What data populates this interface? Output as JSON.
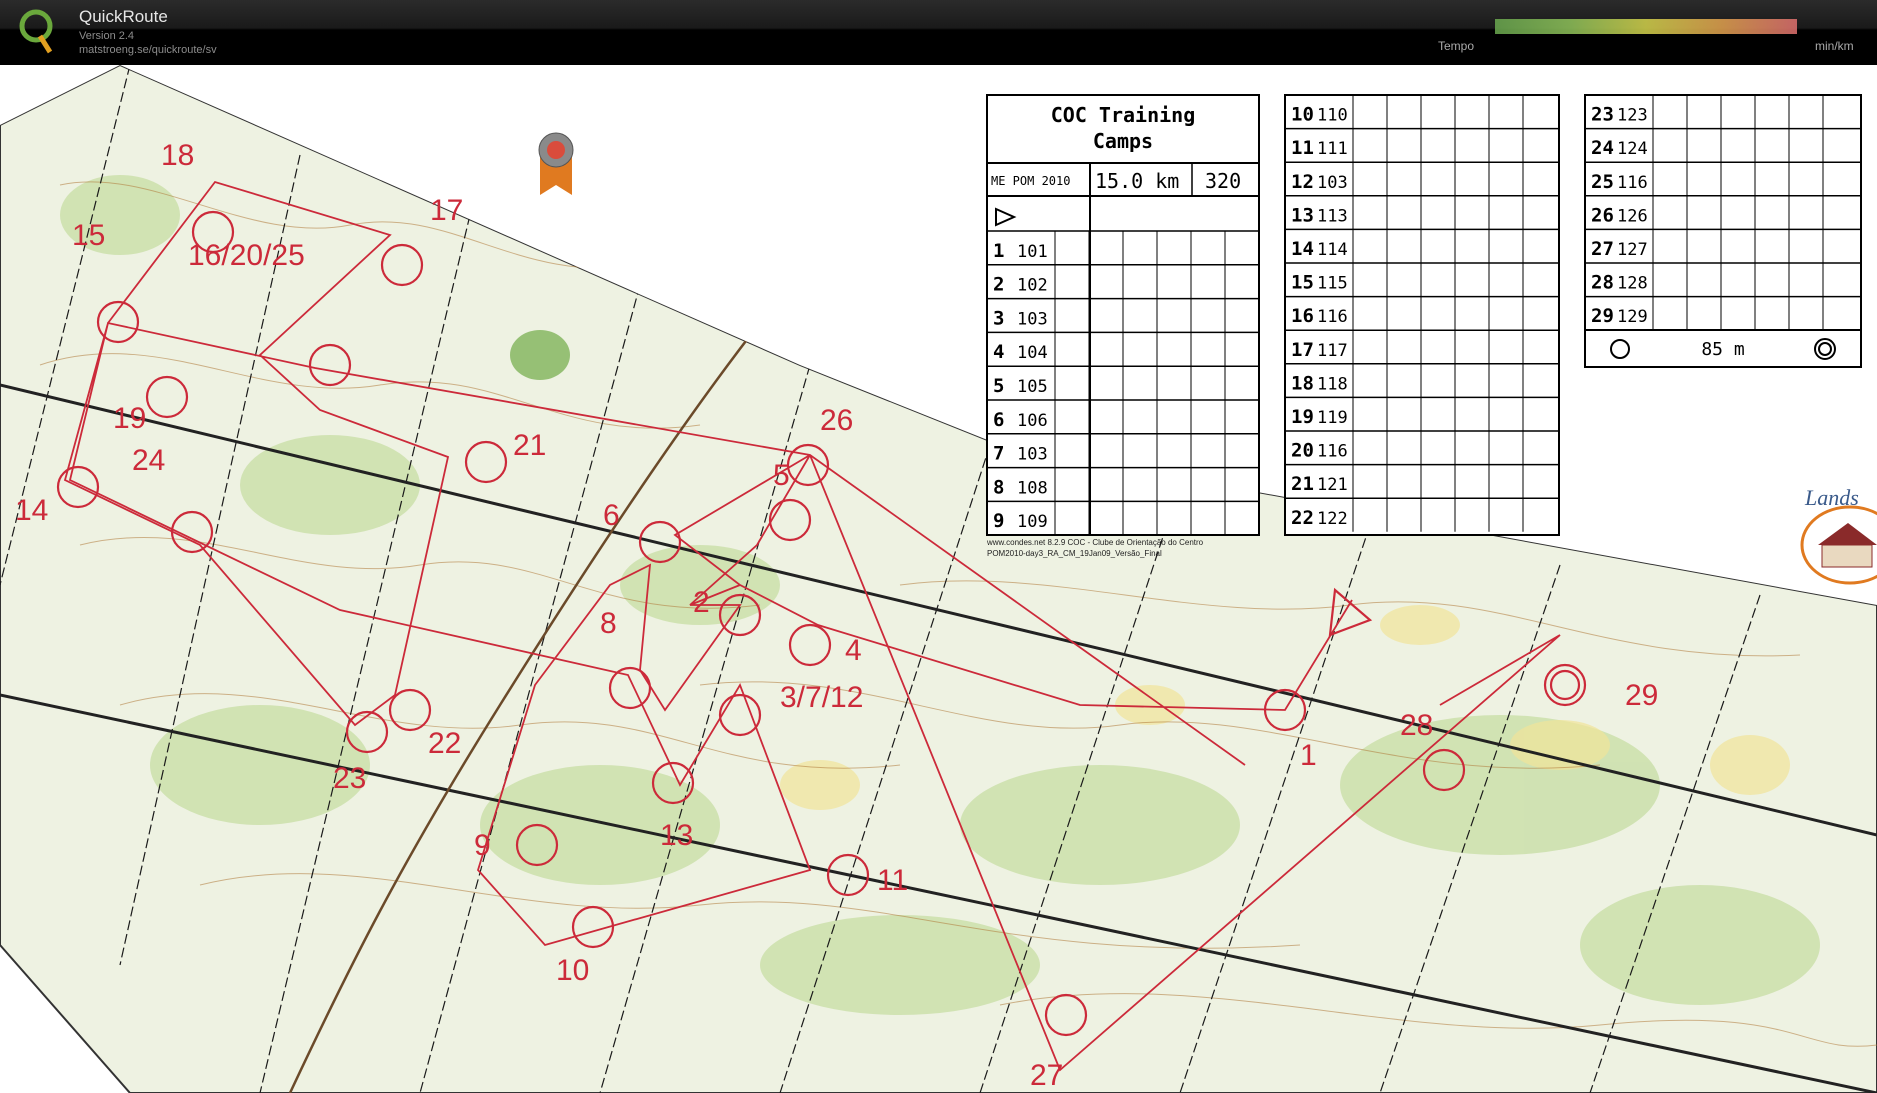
{
  "app": {
    "title": "QuickRoute",
    "version": "Version 2.4",
    "url": "matstroeng.se/quickroute/sv"
  },
  "legend": {
    "tempo_label": "Tempo",
    "unit_label": "min/km"
  },
  "course": {
    "title_line1": "COC Training",
    "title_line2": "Camps",
    "event": "ME POM 2010",
    "length": "15.0 km",
    "climb": "320",
    "finish_distance": "85 m",
    "footer_line1": "www.condes.net 8.2.9 COC - Clube de Orientação do Centro",
    "footer_line2": "POM2010-day3_RA_CM_19Jan09_Versão_Final",
    "controls": [
      {
        "n": "1",
        "code": "101"
      },
      {
        "n": "2",
        "code": "102"
      },
      {
        "n": "3",
        "code": "103"
      },
      {
        "n": "4",
        "code": "104"
      },
      {
        "n": "5",
        "code": "105"
      },
      {
        "n": "6",
        "code": "106"
      },
      {
        "n": "7",
        "code": "103"
      },
      {
        "n": "8",
        "code": "108"
      },
      {
        "n": "9",
        "code": "109"
      },
      {
        "n": "10",
        "code": "110"
      },
      {
        "n": "11",
        "code": "111"
      },
      {
        "n": "12",
        "code": "103"
      },
      {
        "n": "13",
        "code": "113"
      },
      {
        "n": "14",
        "code": "114"
      },
      {
        "n": "15",
        "code": "115"
      },
      {
        "n": "16",
        "code": "116"
      },
      {
        "n": "17",
        "code": "117"
      },
      {
        "n": "18",
        "code": "118"
      },
      {
        "n": "19",
        "code": "119"
      },
      {
        "n": "20",
        "code": "116"
      },
      {
        "n": "21",
        "code": "121"
      },
      {
        "n": "22",
        "code": "122"
      },
      {
        "n": "23",
        "code": "123"
      },
      {
        "n": "24",
        "code": "124"
      },
      {
        "n": "25",
        "code": "116"
      },
      {
        "n": "26",
        "code": "126"
      },
      {
        "n": "27",
        "code": "127"
      },
      {
        "n": "28",
        "code": "128"
      },
      {
        "n": "29",
        "code": "129"
      }
    ]
  },
  "map_labels": [
    "1",
    "2",
    "3/7/12",
    "4",
    "5",
    "6",
    "8",
    "9",
    "10",
    "11",
    "13",
    "14",
    "15",
    "16/20/25",
    "17",
    "18",
    "19",
    "21",
    "22",
    "23",
    "24",
    "26",
    "27",
    "28",
    "29"
  ],
  "colors": {
    "course_red": "#cc2a3a",
    "map_green": "#8fbf5a",
    "contour_brown": "#b07a3a",
    "topbar": "#000000"
  }
}
